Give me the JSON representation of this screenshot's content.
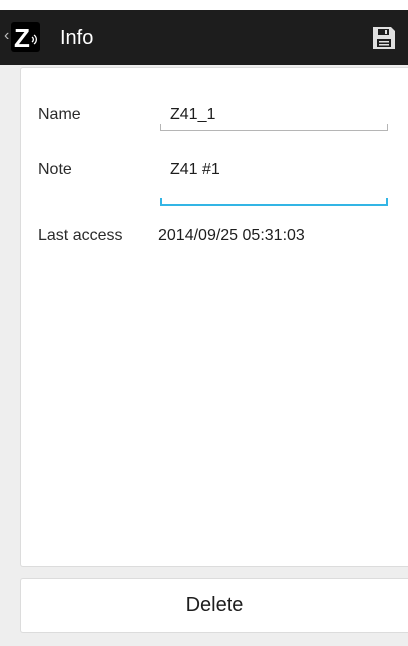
{
  "header": {
    "title": "Info",
    "back_icon": "chevron-left-icon",
    "logo_icon": "z-wave-logo-icon",
    "logo_letter": "Z",
    "save_icon": "floppy-disk-icon"
  },
  "form": {
    "name_label": "Name",
    "name_value": "Z41_1",
    "note_label": "Note",
    "note_value": "Z41 #1",
    "last_access_label": "Last access",
    "last_access_value": "2014/09/25 05:31:03"
  },
  "delete_label": "Delete",
  "colors": {
    "actionbar": "#1d1d1d",
    "focus_underline": "#33b5e5",
    "background": "#eeeeee"
  }
}
